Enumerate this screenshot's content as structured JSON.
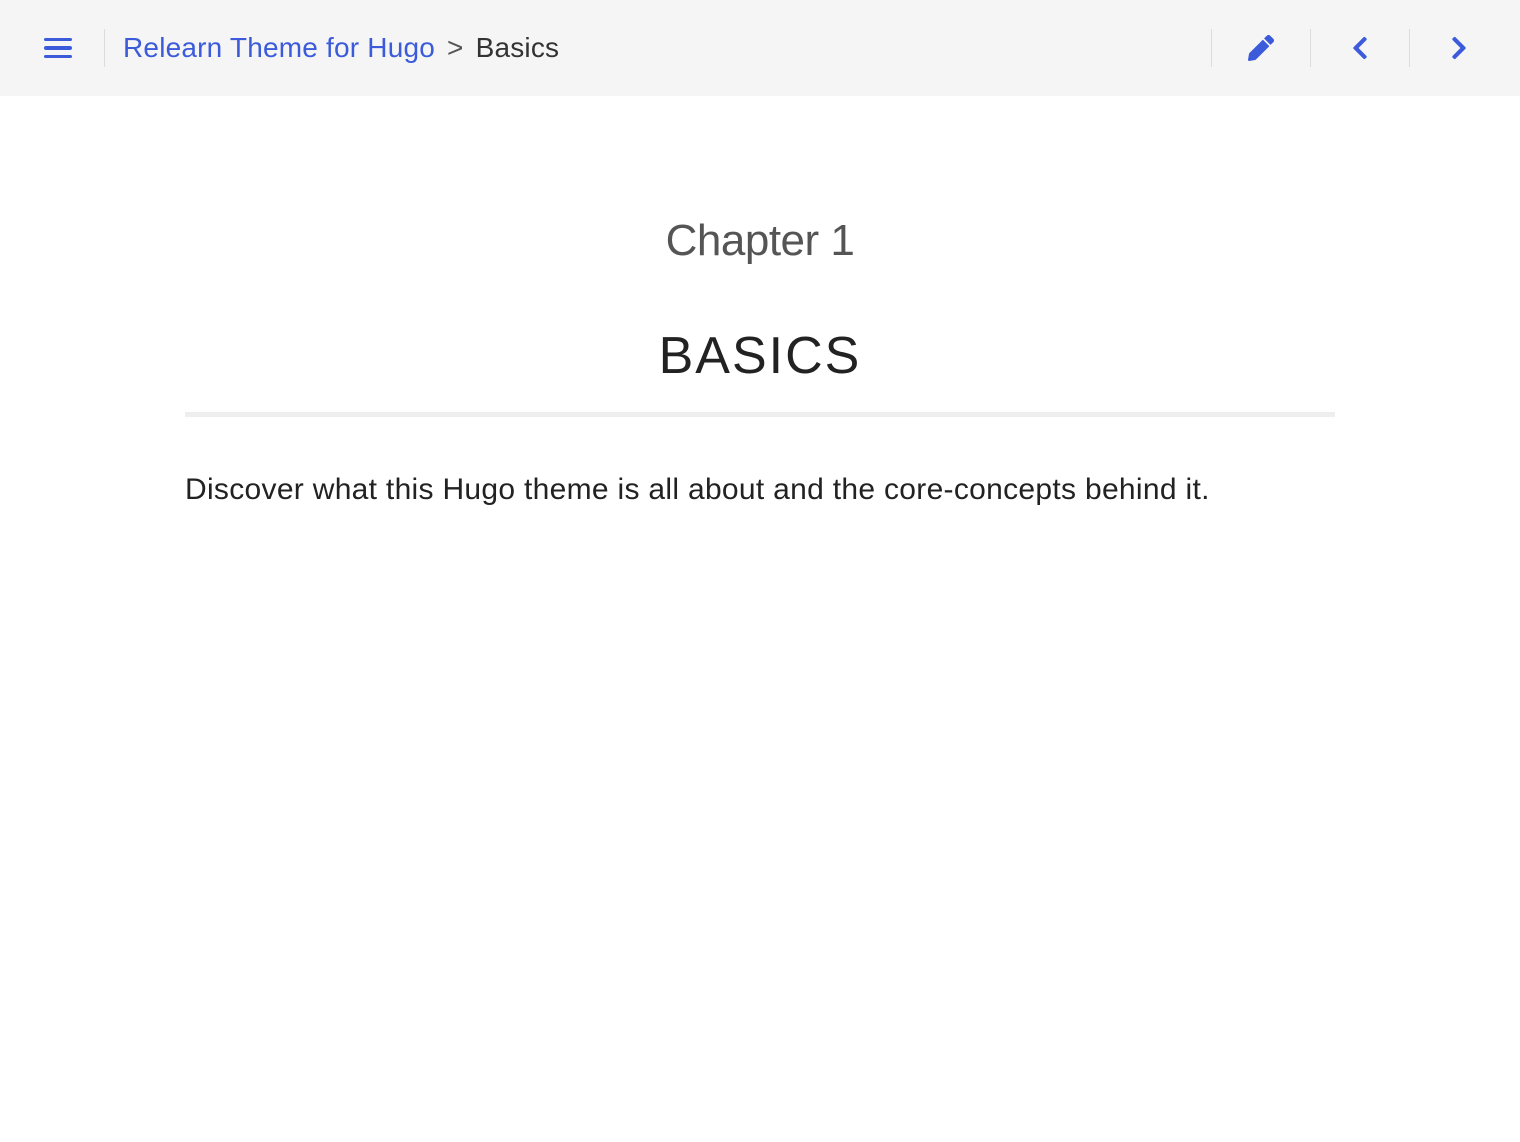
{
  "breadcrumb": {
    "root": "Relearn Theme for Hugo",
    "separator": ">",
    "current": "Basics"
  },
  "chapter": {
    "label": "Chapter 1",
    "title": "BASICS",
    "description": "Discover what this Hugo theme is all about and the core-concepts behind it."
  },
  "colors": {
    "accent": "#3b5bdb",
    "topbar_bg": "#f5f5f5"
  }
}
